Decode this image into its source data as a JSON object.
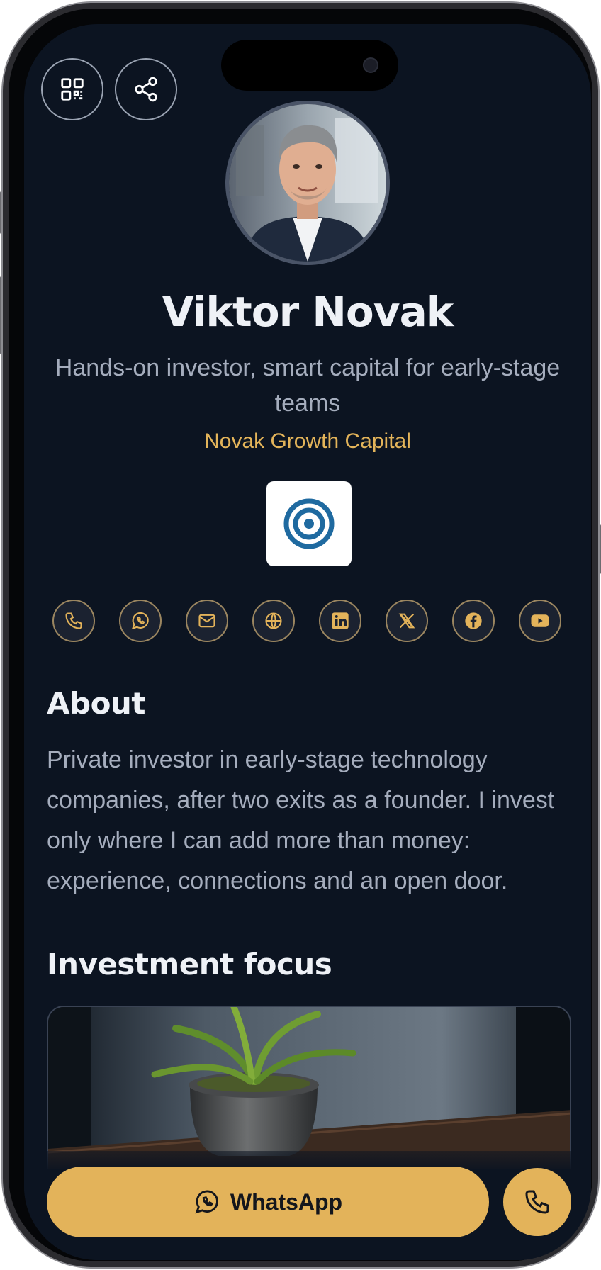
{
  "profile": {
    "name": "Viktor Novak",
    "tagline": "Hands-on investor, smart capital for early-stage teams",
    "company": "Novak Growth Capital"
  },
  "top_actions": {
    "qr_icon": "qr-code-icon",
    "share_icon": "share-icon"
  },
  "social_links": [
    {
      "icon": "phone-icon"
    },
    {
      "icon": "whatsapp-icon"
    },
    {
      "icon": "email-icon"
    },
    {
      "icon": "globe-icon"
    },
    {
      "icon": "linkedin-icon"
    },
    {
      "icon": "x-icon"
    },
    {
      "icon": "facebook-icon"
    },
    {
      "icon": "youtube-icon"
    }
  ],
  "about": {
    "heading": "About",
    "text": "Private investor in early-stage technology companies, after two exits as a founder. I invest only where I can add more than money: experience, connections and an open door."
  },
  "focus": {
    "heading": "Investment focus"
  },
  "bottom_bar": {
    "whatsapp_label": "WhatsApp",
    "call_icon": "phone-icon"
  },
  "colors": {
    "background": "#0c1421",
    "accent": "#e3b35a",
    "text_primary": "#eef1f6",
    "text_secondary": "#a5adbd"
  }
}
